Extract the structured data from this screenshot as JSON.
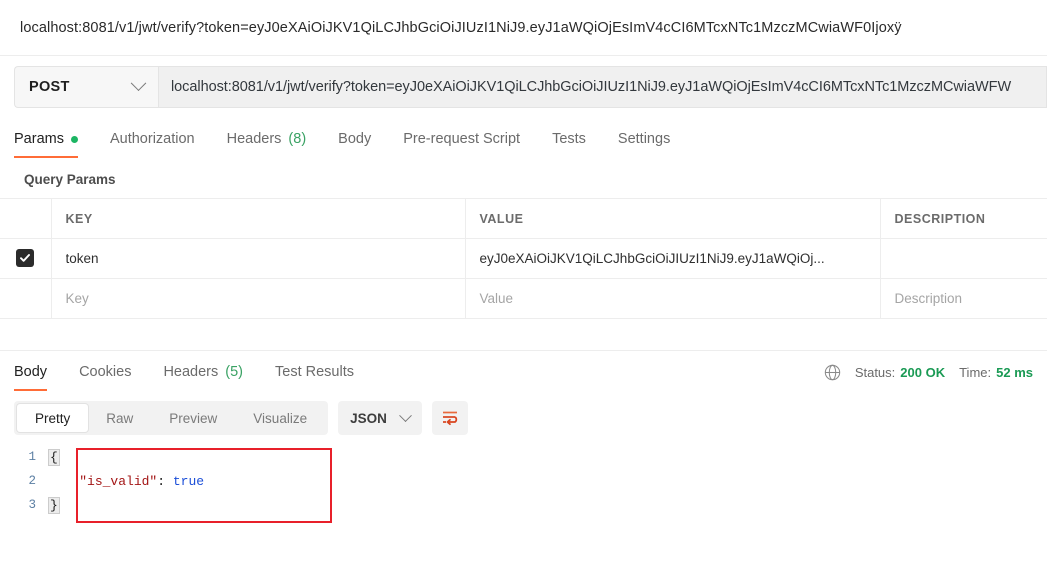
{
  "top_url": {
    "text": "localhost:8081/v1/jwt/verify?token=eyJ0eXAiOiJKV1QiLCJhbGciOiJIUzI1NiJ9.eyJ1aWQiOjEsImV4cCI6MTcxNTc1MzczMCwiaWF0Ijoxÿ"
  },
  "request": {
    "method": "POST",
    "url_value": "localhost:8081/v1/jwt/verify?token=eyJ0eXAiOiJKV1QiLCJhbGciOiJIUzI1NiJ9.eyJ1aWQiOjEsImV4cCI6MTcxNTc1MzczMCwiaWFW",
    "tabs": [
      {
        "label": "Params",
        "badge": "",
        "dot": true,
        "active": true
      },
      {
        "label": "Authorization",
        "badge": "",
        "dot": false,
        "active": false
      },
      {
        "label": "Headers",
        "badge": "(8)",
        "dot": false,
        "active": false
      },
      {
        "label": "Body",
        "badge": "",
        "dot": false,
        "active": false
      },
      {
        "label": "Pre-request Script",
        "badge": "",
        "dot": false,
        "active": false
      },
      {
        "label": "Tests",
        "badge": "",
        "dot": false,
        "active": false
      },
      {
        "label": "Settings",
        "badge": "",
        "dot": false,
        "active": false
      }
    ]
  },
  "query_params": {
    "section_title": "Query Params",
    "columns": [
      "KEY",
      "VALUE",
      "DESCRIPTION"
    ],
    "rows": [
      {
        "checked": true,
        "key": "token",
        "value": "eyJ0eXAiOiJKV1QiLCJhbGciOiJIUzI1NiJ9.eyJ1aWQiOj...",
        "description": ""
      }
    ],
    "placeholder_row": {
      "key": "Key",
      "value": "Value",
      "description": "Description"
    }
  },
  "response": {
    "tabs": [
      {
        "label": "Body",
        "badge": "",
        "active": true
      },
      {
        "label": "Cookies",
        "badge": "",
        "active": false
      },
      {
        "label": "Headers",
        "badge": "(5)",
        "active": false
      },
      {
        "label": "Test Results",
        "badge": "",
        "active": false
      }
    ],
    "status_label": "Status:",
    "status_value": "200 OK",
    "time_label": "Time:",
    "time_value": "52 ms",
    "format_tabs": [
      {
        "label": "Pretty",
        "active": true
      },
      {
        "label": "Raw",
        "active": false
      },
      {
        "label": "Preview",
        "active": false
      },
      {
        "label": "Visualize",
        "active": false
      }
    ],
    "language": "JSON",
    "body_lines": [
      {
        "num": "1",
        "segments": [
          {
            "text": "{",
            "type": "fold"
          }
        ]
      },
      {
        "num": "2",
        "segments": [
          {
            "text": "    ",
            "type": "plain"
          },
          {
            "text": "\"is_valid\"",
            "type": "key"
          },
          {
            "text": ": ",
            "type": "plain"
          },
          {
            "text": "true",
            "type": "bool"
          }
        ]
      },
      {
        "num": "3",
        "segments": [
          {
            "text": "}",
            "type": "fold"
          }
        ]
      }
    ]
  },
  "colors": {
    "accent": "#ff6c37",
    "success": "#1a9a54",
    "dot": "#1cb563",
    "annotation": "#e8202a"
  }
}
